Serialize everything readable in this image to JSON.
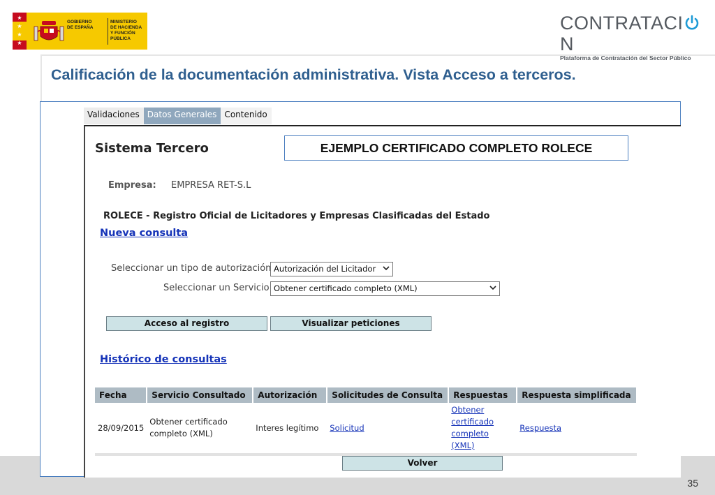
{
  "header": {
    "gov_logo_line1": "GOBIERNO\nDE ESPAÑA",
    "gov_logo_line2": "MINISTERIO\nDE HACIENDA\nY FUNCIÓN PÚBLICA",
    "brand_word": "CONTRATACI",
    "brand_last_letter": "N",
    "brand_subtitle": "Plataforma de Contratación del Sector Público"
  },
  "slide": {
    "title": "Calificación de la documentación administrativa. Vista Acceso a terceros.",
    "page_number": "35"
  },
  "tabs": [
    {
      "label": "Validaciones"
    },
    {
      "label": "Datos Generales"
    },
    {
      "label": "Contenido"
    }
  ],
  "panel": {
    "system_title": "Sistema Tercero",
    "example_label": "EJEMPLO CERTIFICADO COMPLETO ROLECE",
    "empresa_label": "Empresa:",
    "empresa_value": "EMPRESA RET-S.L",
    "rolece_heading": "ROLECE - Registro Oficial de Licitadores y Empresas Clasificadas del Estado",
    "nueva_consulta": "Nueva consulta",
    "tipo_autorizacion_label": "Seleccionar un tipo de autorización",
    "tipo_autorizacion_value": "Autorización del Licitador",
    "servicio_label": "Seleccionar un Servicio",
    "servicio_value": "Obtener certificado completo (XML)",
    "btn_acceso": "Acceso al registro",
    "btn_visualizar": "Visualizar peticiones",
    "historico": "Histórico de consultas",
    "btn_volver": "Volver"
  },
  "table": {
    "headers": [
      "Fecha",
      "Servicio Consultado",
      "Autorización",
      "Solicitudes de Consulta",
      "Respuestas",
      "Respuesta simplificada"
    ],
    "rows": [
      {
        "fecha": "28/09/2015",
        "servicio": "Obtener certificado completo (XML)",
        "autorizacion": "Interes legítimo",
        "solicitud": "Solicitud",
        "respuestas": "Obtener certificado completo (XML)",
        "respuesta_simplificada": "Respuesta"
      }
    ]
  },
  "icons": {
    "dropdown": "chevron-down-icon",
    "power": "power-icon",
    "coat_of_arms": "coat-of-arms-icon"
  },
  "colors": {
    "title_blue": "#2f5f8f",
    "link_blue": "#1533b8",
    "tab_active": "#8fa7bd",
    "button_fill": "#cde3e6",
    "table_header": "#aebbc4",
    "gov_yellow": "#f6c900",
    "gov_red": "#c60b1e"
  }
}
